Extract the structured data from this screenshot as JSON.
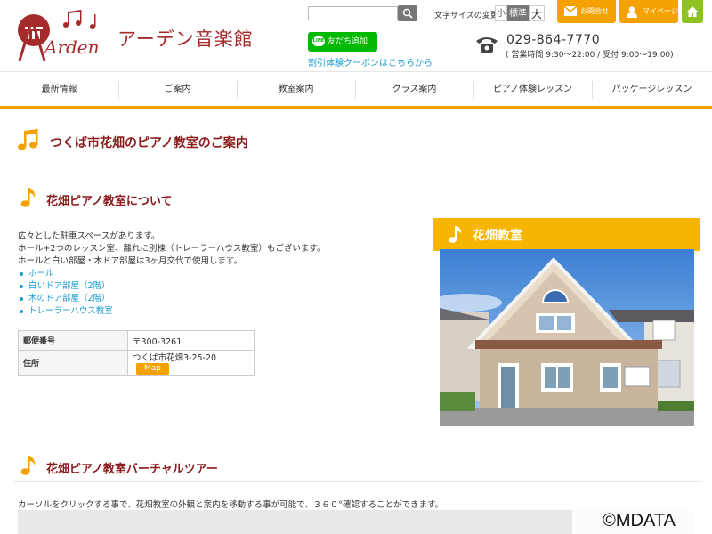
{
  "header": {
    "logo_text": "Arden",
    "site_title": "アーデン音楽館",
    "search_placeholder": "",
    "font_size_label": "文字サイズの変更",
    "font_sizes": {
      "small": "小",
      "standard": "標準",
      "large": "大"
    },
    "contact_label": "お問合せ",
    "mypage_label": "マイページ",
    "line_button_label": "友だち追加",
    "line_icon_text": "LINE",
    "coupon_link": "割引体験クーポンはこちらから",
    "phone": "029-864-7770",
    "hours": "( 営業時間 9:30～22:00 / 受付 9:00～19:00)"
  },
  "nav": {
    "items": [
      "最新情報",
      "ご案内",
      "教室案内",
      "クラス案内",
      "ピアノ体験レッスン",
      "パッケージレッスン"
    ]
  },
  "page": {
    "title": "つくば市花畑のピアノ教室のご案内"
  },
  "about": {
    "heading": "花畑ピアノ教室について",
    "lines": [
      "広々とした駐車スペースがあります。",
      "ホール+2つのレッスン室、離れに別棟（トレーラーハウス教室）もございます。",
      "ホールと白い部屋・木ドア部屋は3ヶ月交代で使用します。"
    ],
    "rooms": [
      "ホール",
      "白いドア部屋（2階）",
      "木のドア部屋（2階）",
      "トレーラーハウス教室"
    ],
    "table": {
      "postal_label": "郵便番号",
      "postal_value": "〒300-3261",
      "address_label": "住所",
      "address_value": "つくば市花畑3-25-20",
      "map_label": "Map"
    }
  },
  "photo": {
    "title": "花畑教室"
  },
  "tour": {
    "heading": "花畑ピアノ教室バーチャルツアー",
    "description": "カーソルをクリックする事で、花畑教室の外観と案内を移動する事が可能で、３６０°確認することができます。"
  },
  "watermark": "©MDATA",
  "colors": {
    "accent": "#f5a200",
    "heading": "#8b1a1a",
    "link": "#1a9cd1",
    "line": "#00b900",
    "home": "#8dc21f"
  }
}
